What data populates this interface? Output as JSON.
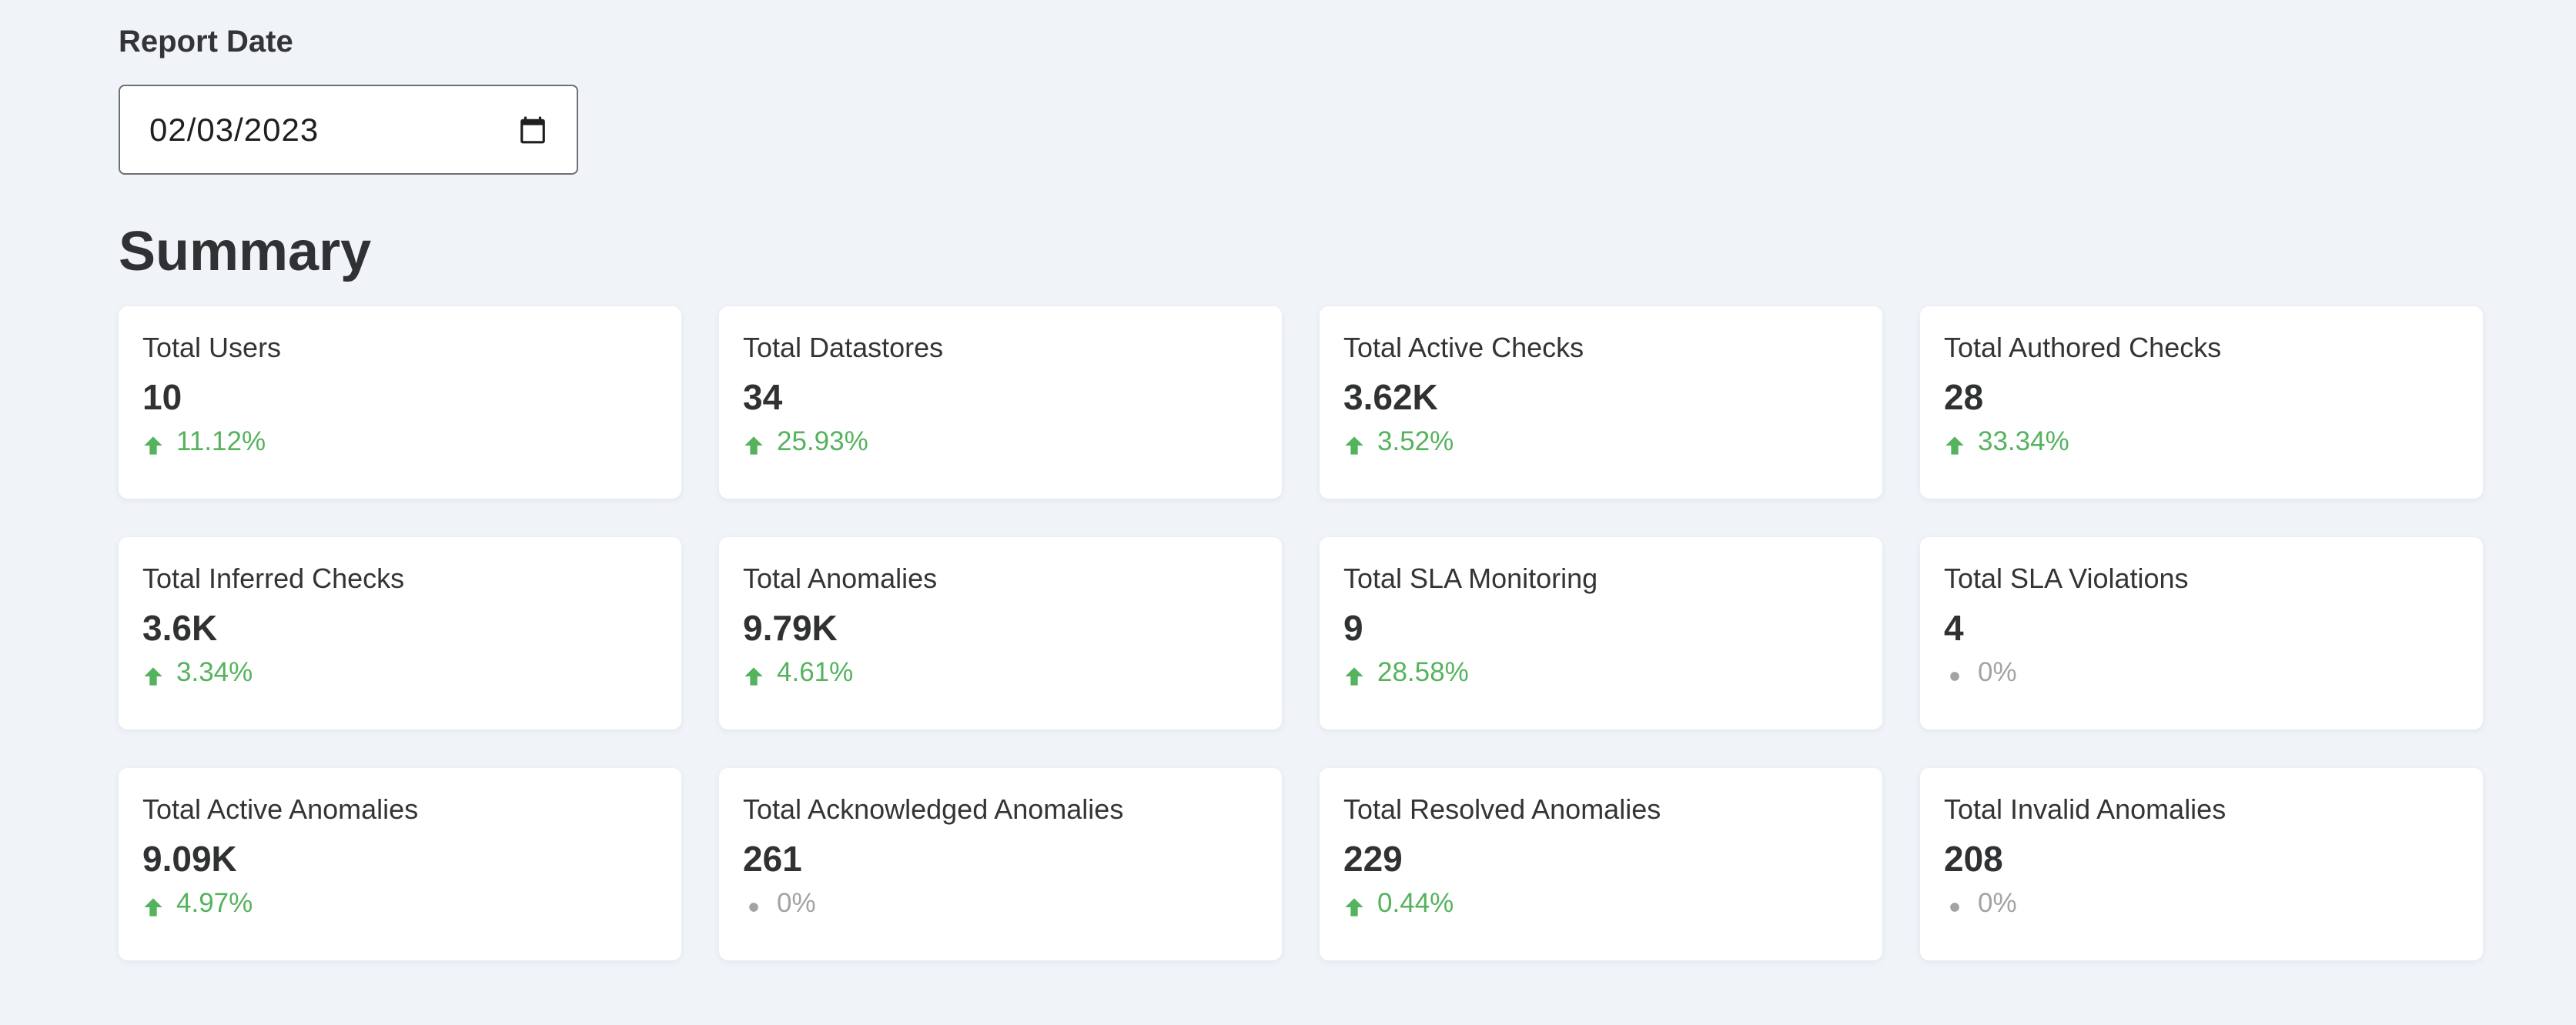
{
  "report_date": {
    "label": "Report Date",
    "value": "02/03/2023",
    "icon": "calendar-icon"
  },
  "summary": {
    "title": "Summary",
    "cards": [
      {
        "label": "Total Users",
        "value": "10",
        "change": "11.12%",
        "trend": "up"
      },
      {
        "label": "Total Datastores",
        "value": "34",
        "change": "25.93%",
        "trend": "up"
      },
      {
        "label": "Total Active Checks",
        "value": "3.62K",
        "change": "3.52%",
        "trend": "up"
      },
      {
        "label": "Total Authored Checks",
        "value": "28",
        "change": "33.34%",
        "trend": "up"
      },
      {
        "label": "Total Inferred Checks",
        "value": "3.6K",
        "change": "3.34%",
        "trend": "up"
      },
      {
        "label": "Total Anomalies",
        "value": "9.79K",
        "change": "4.61%",
        "trend": "up"
      },
      {
        "label": "Total SLA Monitoring",
        "value": "9",
        "change": "28.58%",
        "trend": "up"
      },
      {
        "label": "Total SLA Violations",
        "value": "4",
        "change": "0%",
        "trend": "flat"
      },
      {
        "label": "Total Active Anomalies",
        "value": "9.09K",
        "change": "4.97%",
        "trend": "up"
      },
      {
        "label": "Total Acknowledged Anomalies",
        "value": "261",
        "change": "0%",
        "trend": "flat"
      },
      {
        "label": "Total Resolved Anomalies",
        "value": "229",
        "change": "0.44%",
        "trend": "up"
      },
      {
        "label": "Total Invalid Anomalies",
        "value": "208",
        "change": "0%",
        "trend": "flat"
      }
    ]
  },
  "colors": {
    "background": "#f0f4f9",
    "card": "#ffffff",
    "positive": "#55b25d",
    "neutral": "#a3a3a6",
    "text": "#2f3133"
  }
}
